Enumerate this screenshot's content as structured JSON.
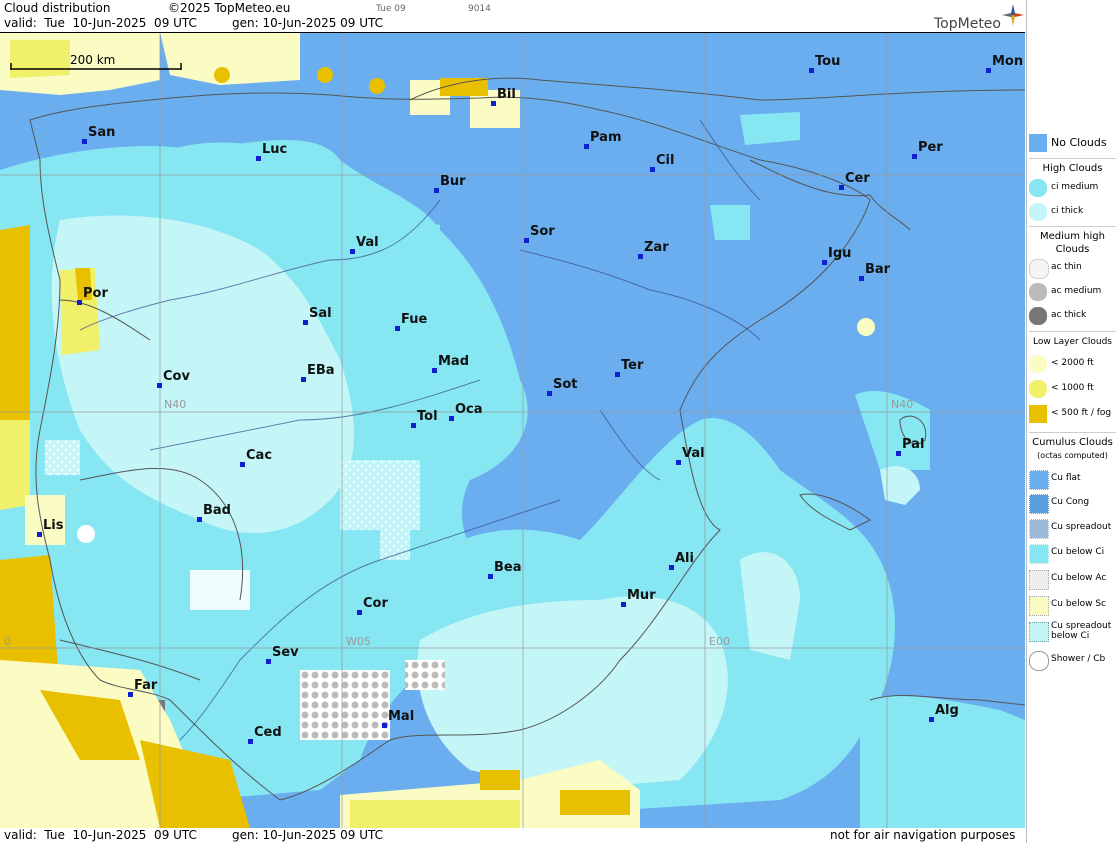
{
  "header": {
    "title": "Cloud distribution",
    "copyright": "©2025 TopMeteo.eu",
    "valid": "valid:  Tue  10-Jun-2025  09 UTC",
    "gen": "gen: 10-Jun-2025 09 UTC",
    "time_tag": "Tue 09",
    "code": "9014",
    "brand": "TopMeteo"
  },
  "scale": {
    "label": "200 km"
  },
  "footer": {
    "valid": "valid:  Tue  10-Jun-2025  09 UTC",
    "gen": "gen: 10-Jun-2025 09 UTC",
    "disclaimer": "not for air navigation purposes"
  },
  "grid_labels": {
    "n40_left": "N40",
    "n40_right": "N40",
    "w05": "W05",
    "e00": "E00",
    "w10": "0"
  },
  "cities": [
    {
      "name": "Tou"
    },
    {
      "name": "Mon"
    },
    {
      "name": "Bil"
    },
    {
      "name": "San"
    },
    {
      "name": "Pam"
    },
    {
      "name": "Luc"
    },
    {
      "name": "Cil"
    },
    {
      "name": "Per"
    },
    {
      "name": "Bur"
    },
    {
      "name": "Cer"
    },
    {
      "name": "Sor"
    },
    {
      "name": "Val"
    },
    {
      "name": "Zar"
    },
    {
      "name": "Igu"
    },
    {
      "name": "Bar"
    },
    {
      "name": "Por"
    },
    {
      "name": "Sal"
    },
    {
      "name": "Fue"
    },
    {
      "name": "Mad"
    },
    {
      "name": "Cov"
    },
    {
      "name": "EBa"
    },
    {
      "name": "Ter"
    },
    {
      "name": "Sot"
    },
    {
      "name": "Tol"
    },
    {
      "name": "Oca"
    },
    {
      "name": "Pal"
    },
    {
      "name": "Cac"
    },
    {
      "name": "Val"
    },
    {
      "name": "Bad"
    },
    {
      "name": "Lis"
    },
    {
      "name": "Bea"
    },
    {
      "name": "Ali"
    },
    {
      "name": "Mur"
    },
    {
      "name": "Cor"
    },
    {
      "name": "Sev"
    },
    {
      "name": "Far"
    },
    {
      "name": "Alg"
    },
    {
      "name": "Mal"
    },
    {
      "name": "Ced"
    }
  ],
  "legend": {
    "no_clouds": "No Clouds",
    "high_head": "High Clouds",
    "ci_medium": "ci medium",
    "ci_thick": "ci thick",
    "medium_head": "Medium high Clouds",
    "ac_thin": "ac thin",
    "ac_medium": "ac medium",
    "ac_thick": "ac thick",
    "low_head": "Low Layer Clouds",
    "low_2000": "< 2000 ft",
    "low_1000": "< 1000 ft",
    "low_500": "< 500 ft / fog",
    "cu_head": "Cumulus Clouds",
    "cu_sub": "(octas computed)",
    "cu_flat": "Cu flat",
    "cu_cong": "Cu Cong",
    "cu_spread": "Cu spreadout",
    "cu_below_ci": "Cu below Ci",
    "cu_below_ac": "Cu below Ac",
    "cu_below_sc": "Cu below Sc",
    "cu_spread_ci": "Cu spreadout below Ci",
    "shower": "Shower / Cb"
  },
  "colors": {
    "no_clouds": "#6aaef0",
    "ci_medium": "#86e6f2",
    "ci_thick": "#c4f6f8",
    "low_2000": "#fafcc4",
    "low_1000": "#f0f06a",
    "low_500": "#e8c000",
    "ac_medium": "#bbbbbb",
    "ac_thick": "#777777"
  }
}
